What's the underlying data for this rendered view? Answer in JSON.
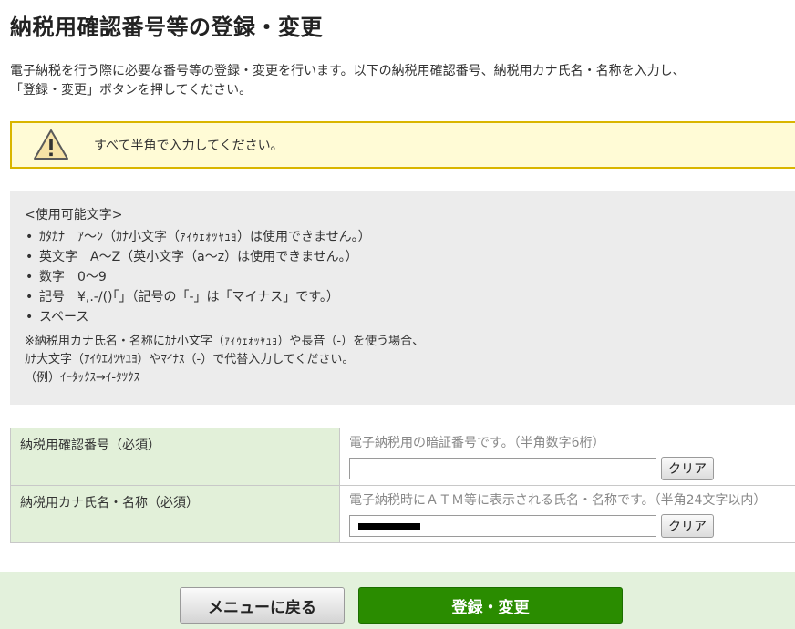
{
  "page": {
    "title": "納税用確認番号等の登録・変更",
    "description_line1": "電子納税を行う際に必要な番号等の登録・変更を行います。以下の納税用確認番号、納税用カナ氏名・名称を入力し、",
    "description_line2": "「登録・変更」ボタンを押してください。"
  },
  "warning": {
    "icon": "warning-triangle-icon",
    "text": "すべて半角で入力してください。"
  },
  "allowed_chars": {
    "heading": "<使用可能文字>",
    "items": [
      "ｶﾀｶﾅ　ｱ～ﾝ（ｶﾅ小文字（ｧｨｩｪｫｯｬｭｮ）は使用できません。）",
      "英文字　A～Z（英小文字（a～z）は使用できません。）",
      "数字　0～9",
      "記号　¥,.-/()｢｣（記号の「-」は「マイナス」です。）",
      "スペース"
    ],
    "note_line1": "※納税用カナ氏名・名称にｶﾅ小文字（ｧｨｩｪｫｯｬｭｮ）や長音（-）を使う場合、",
    "note_line2": "ｶﾅ大文字（ｱｲｳｴｵﾂﾔﾕﾖ）やﾏｲﾅｽ（-）で代替入力してください。",
    "note_line3": "（例）ｲｰﾀｯｸｽ→ｲ-ﾀﾂｸｽ"
  },
  "form": {
    "rows": [
      {
        "label": "納税用確認番号（必須）",
        "hint": "電子納税用の暗証番号です。（半角数字6桁）",
        "value": "",
        "clear_label": "クリア"
      },
      {
        "label": "納税用カナ氏名・名称（必須）",
        "hint": "電子納税時にＡＴＭ等に表示される氏名・名称です。（半角24文字以内）",
        "value": "",
        "clear_label": "クリア"
      }
    ]
  },
  "footer": {
    "back_label": "メニューに戻る",
    "submit_label": "登録・変更"
  },
  "colors": {
    "warning_bg": "#fffbd6",
    "warning_border": "#d9b500",
    "label_bg": "#e2f0d9",
    "submit_bg": "#2a8c00",
    "footer_bg": "#e3f1dc"
  }
}
